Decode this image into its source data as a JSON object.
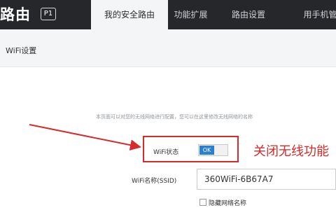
{
  "header": {
    "brand": "路由",
    "model_badge": "P1",
    "tabs": [
      {
        "label": "我的安全路由",
        "active": true
      },
      {
        "label": "功能扩展",
        "active": false
      },
      {
        "label": "路由设置",
        "active": false
      },
      {
        "label": "用手机管",
        "active": false
      }
    ]
  },
  "section": {
    "title": "WiFi设置"
  },
  "wifi_settings": {
    "intro": "本页面可以对您的无线网络进行配置，您可以在这里修改无线网络的名称",
    "status_label": "WiFi状态",
    "toggle_text": "OK",
    "toggle_on": true,
    "ssid_label": "WiFi名称(SSID)",
    "ssid_value": "360WiFi-6B67A7",
    "hide_network_label": "隐藏网络名称",
    "hide_network_checked": false
  },
  "annotation": {
    "text": "关闭无线功能"
  },
  "colors": {
    "header_bg": "#26272b",
    "accent": "#2b7fd1",
    "annotation": "#d72a2a"
  }
}
